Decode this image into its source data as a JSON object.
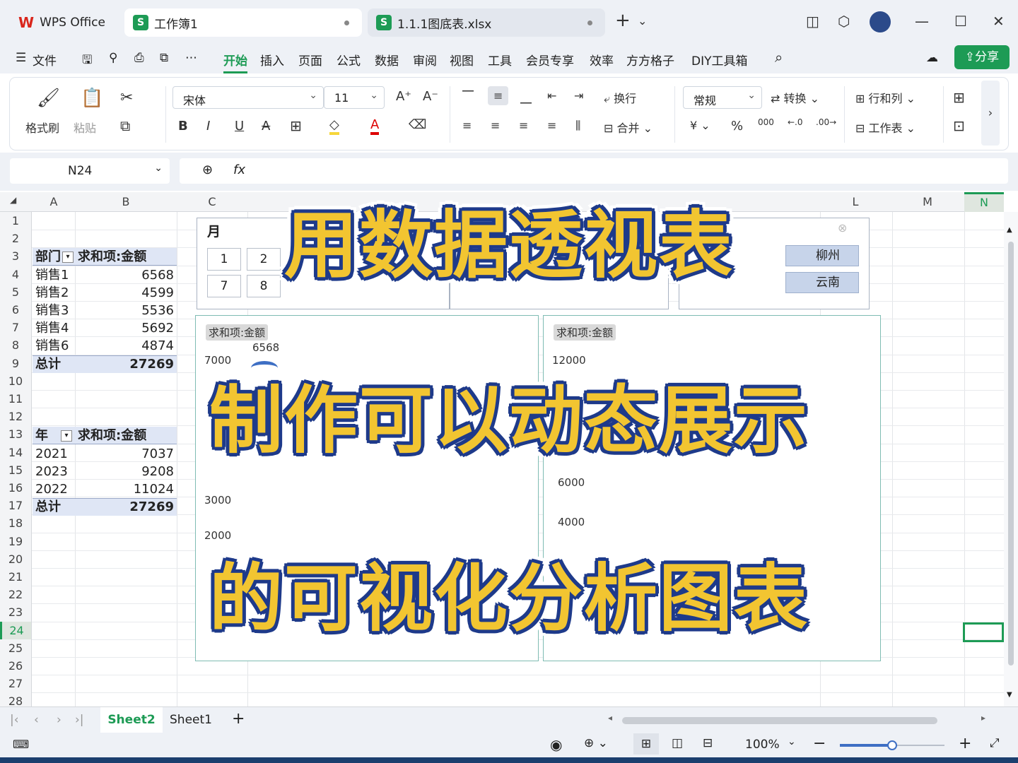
{
  "titlebar": {
    "app": "WPS Office",
    "tabs": [
      {
        "label": "工作簿1"
      },
      {
        "label": "1.1.1图底表.xlsx"
      }
    ],
    "add": "+",
    "more": "⌄"
  },
  "menu": {
    "file": "文件",
    "items": [
      "开始",
      "插入",
      "页面",
      "公式",
      "数据",
      "审阅",
      "视图",
      "工具",
      "会员专享",
      "效率",
      "方方格子",
      "DIY工具箱"
    ],
    "active": "开始",
    "share": "分享"
  },
  "ribbon": {
    "format_painter": "格式刷",
    "paste": "粘贴",
    "font": "宋体",
    "size": "11",
    "wrap": "换行",
    "merge": "合并",
    "numfmt": "常规",
    "convert": "转换",
    "rowcol": "行和列",
    "worksheet": "工作表",
    "currency": "¥",
    "percent": "%",
    "thousands": "000"
  },
  "formula": {
    "cellref": "N24",
    "fx": "fx"
  },
  "columns": [
    "A",
    "B",
    "C",
    "L",
    "M",
    "N"
  ],
  "rows": [
    "1",
    "2",
    "3",
    "4",
    "5",
    "6",
    "7",
    "8",
    "9",
    "10",
    "11",
    "12",
    "13",
    "14",
    "15",
    "16",
    "17",
    "18",
    "19",
    "20",
    "21",
    "22",
    "23",
    "24",
    "25",
    "26",
    "27",
    "28"
  ],
  "pivot1": {
    "h1": "部门",
    "h2": "求和项:金额",
    "rows": [
      [
        "销售1",
        "6568"
      ],
      [
        "销售2",
        "4599"
      ],
      [
        "销售3",
        "5536"
      ],
      [
        "销售4",
        "5692"
      ],
      [
        "销售6",
        "4874"
      ]
    ],
    "total_label": "总计",
    "total": "27269"
  },
  "pivot2": {
    "h1": "年",
    "h2": "求和项:金额",
    "rows": [
      [
        "2021",
        "7037"
      ],
      [
        "2023",
        "9208"
      ],
      [
        "2022",
        "11024"
      ]
    ],
    "total_label": "总计",
    "total": "27269"
  },
  "slicer": {
    "title": "月",
    "buttons": [
      "1",
      "2",
      "7",
      "8"
    ],
    "right_buttons": [
      "柳州",
      "云南"
    ]
  },
  "chart1": {
    "pill": "求和项:金额",
    "label": "6568",
    "yticks": [
      "7000",
      "3000",
      "2000"
    ]
  },
  "chart2": {
    "pill": "求和项:金额",
    "yticks": [
      "12000",
      "6000",
      "4000"
    ]
  },
  "overlay": {
    "line1": "用数据透视表",
    "line2": "制作可以动态展示",
    "line3": "的可视化分析图表"
  },
  "sheets": {
    "tabs": [
      "Sheet2",
      "Sheet1"
    ],
    "active": "Sheet2",
    "add": "+"
  },
  "status": {
    "zoom": "100%"
  }
}
